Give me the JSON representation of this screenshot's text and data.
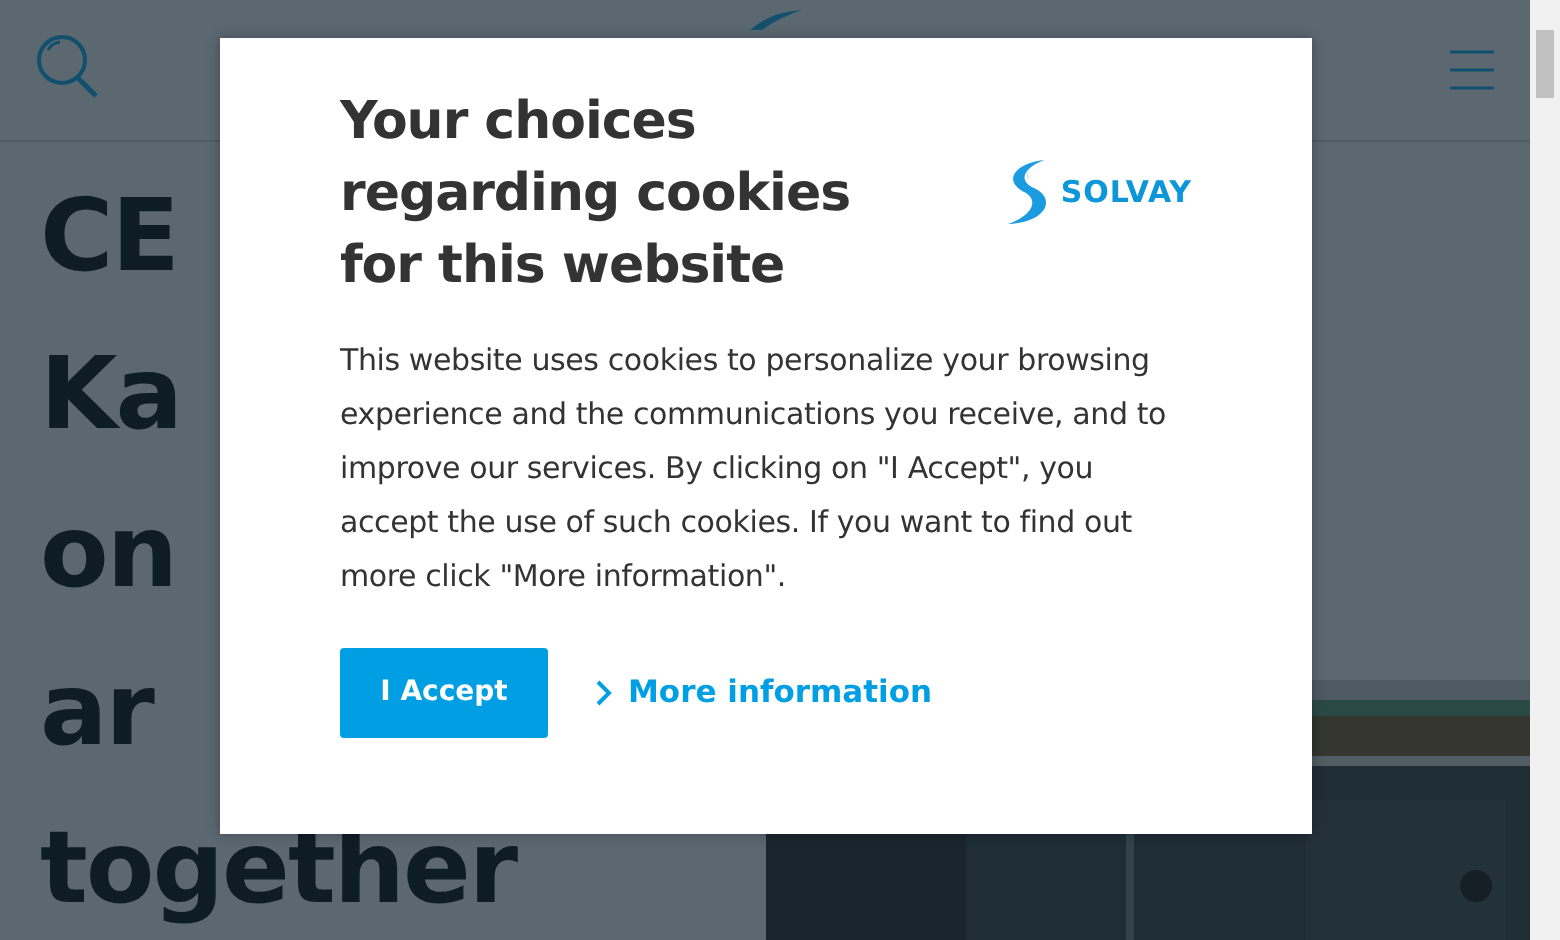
{
  "page": {
    "heading_lines": [
      "CE",
      "Ka",
      "on",
      "ar",
      "together"
    ]
  },
  "cookie_dialog": {
    "title": "Your choices regarding cookies for this website",
    "logo_text": "SOLVAY",
    "body": "This website uses cookies to personalize your browsing experience and the communications you receive, and to improve our services. By clicking on \"I Accept\", you accept the use of such cookies. If you want to find out more click \"More information\".",
    "buttons": [
      {
        "kind": "primary",
        "label": "I Accept"
      },
      {
        "kind": "link",
        "label": "More information"
      }
    ]
  }
}
